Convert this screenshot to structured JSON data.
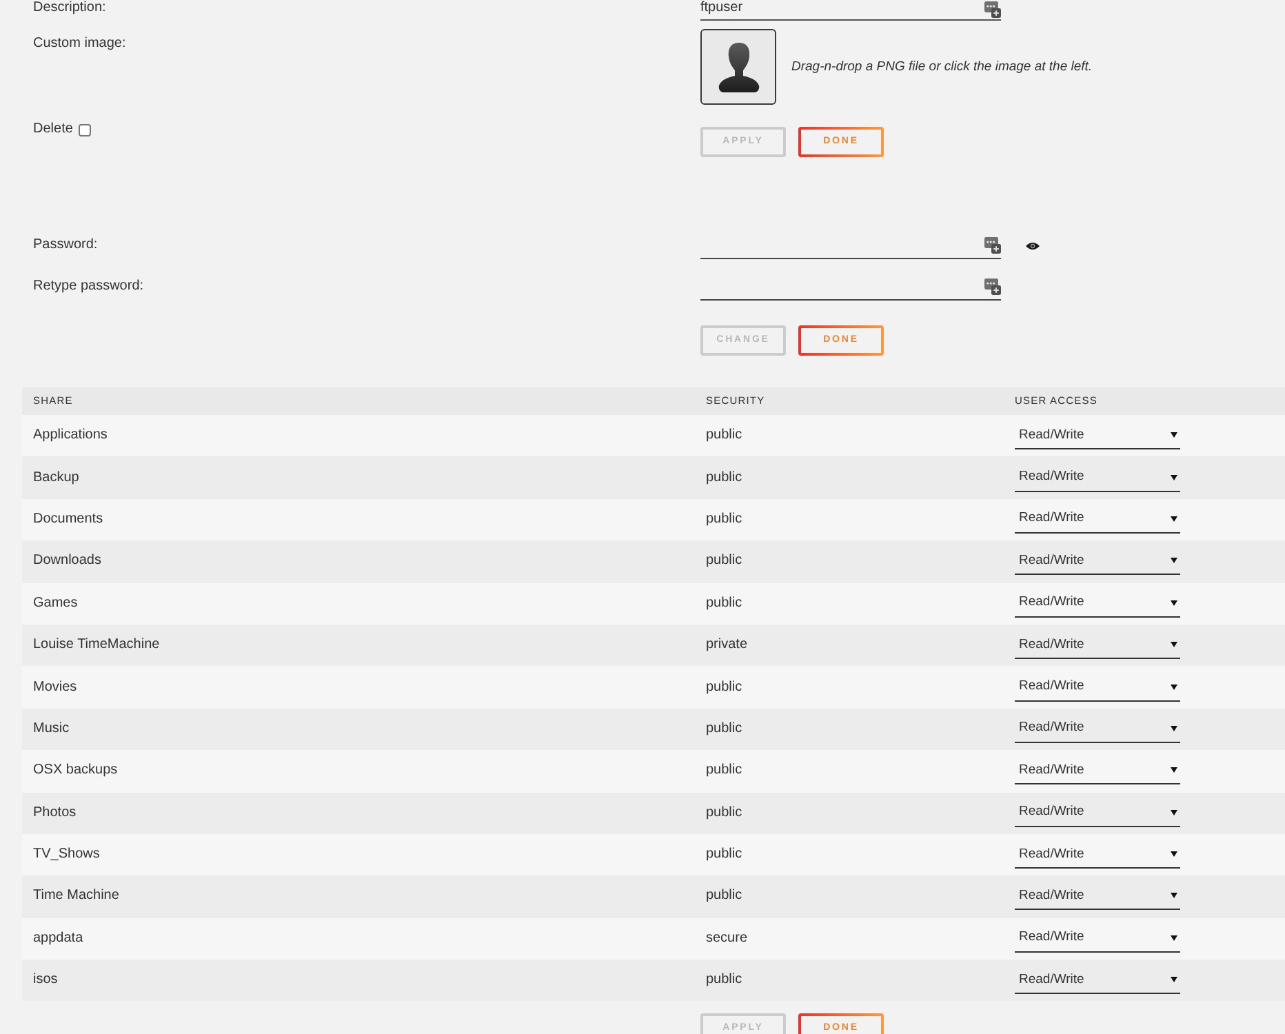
{
  "profile": {
    "description": {
      "label": "Description:",
      "value": "ftpuser"
    },
    "custom_image": {
      "label": "Custom image:",
      "hint": "Drag-n-drop a PNG file or click the image at the left."
    },
    "delete": {
      "label": "Delete",
      "checked": false
    },
    "buttons": [
      {
        "label": "APPLY",
        "disabled": true
      },
      {
        "label": "DONE",
        "disabled": false
      }
    ]
  },
  "password": {
    "fields": [
      {
        "label": "Password:",
        "show_toggle": true
      },
      {
        "label": "Retype password:",
        "show_toggle": false
      }
    ],
    "buttons": [
      {
        "label": "CHANGE",
        "disabled": true
      },
      {
        "label": "DONE",
        "disabled": false
      }
    ]
  },
  "shares_table": {
    "columns": [
      "SHARE",
      "SECURITY",
      "USER ACCESS"
    ],
    "rows": [
      {
        "share": "Applications",
        "security": "public",
        "access": "Read/Write"
      },
      {
        "share": "Backup",
        "security": "public",
        "access": "Read/Write"
      },
      {
        "share": "Documents",
        "security": "public",
        "access": "Read/Write"
      },
      {
        "share": "Downloads",
        "security": "public",
        "access": "Read/Write"
      },
      {
        "share": "Games",
        "security": "public",
        "access": "Read/Write"
      },
      {
        "share": "Louise TimeMachine",
        "security": "private",
        "access": "Read/Write"
      },
      {
        "share": "Movies",
        "security": "public",
        "access": "Read/Write"
      },
      {
        "share": "Music",
        "security": "public",
        "access": "Read/Write"
      },
      {
        "share": "OSX backups",
        "security": "public",
        "access": "Read/Write"
      },
      {
        "share": "Photos",
        "security": "public",
        "access": "Read/Write"
      },
      {
        "share": "TV_Shows",
        "security": "public",
        "access": "Read/Write"
      },
      {
        "share": "Time Machine",
        "security": "public",
        "access": "Read/Write"
      },
      {
        "share": "appdata",
        "security": "secure",
        "access": "Read/Write"
      },
      {
        "share": "isos",
        "security": "public",
        "access": "Read/Write"
      }
    ]
  },
  "footer_buttons": [
    {
      "label": "APPLY",
      "disabled": true
    },
    {
      "label": "DONE",
      "disabled": false
    }
  ]
}
